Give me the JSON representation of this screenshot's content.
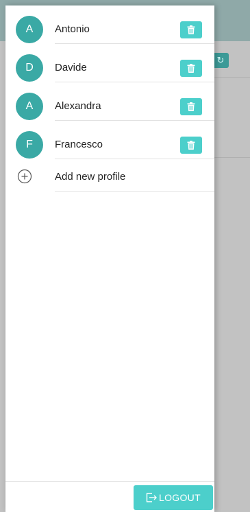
{
  "drawer": {
    "profiles": [
      {
        "initial": "A",
        "name": "Antonio"
      },
      {
        "initial": "D",
        "name": "Davide"
      },
      {
        "initial": "A",
        "name": "Alexandra"
      },
      {
        "initial": "F",
        "name": "Francesco"
      }
    ],
    "add_profile_label": "Add new profile",
    "logout_label": "LOGOUT"
  },
  "icons": {
    "delete": "trash-icon",
    "add": "plus-circle-icon",
    "logout": "logout-icon",
    "refresh": "refresh-icon"
  },
  "colors": {
    "accent": "#4ccfcb",
    "avatar": "#3aa9a5",
    "overlay": "#c2c2c2"
  }
}
